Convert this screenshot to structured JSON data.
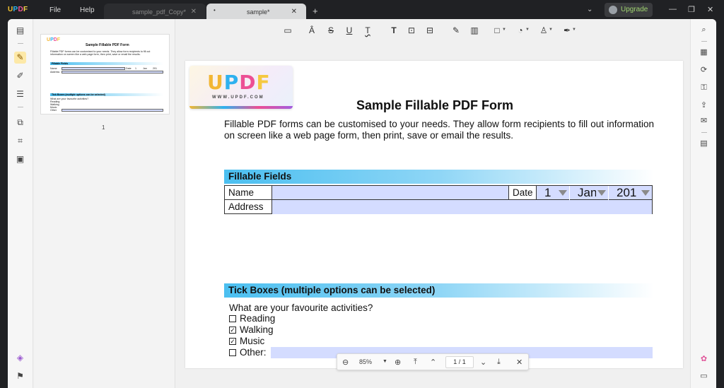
{
  "titlebar": {
    "logo": {
      "u": "U",
      "p": "P",
      "d": "D",
      "f": "F"
    },
    "menu": [
      "File",
      "Help"
    ],
    "tabs": [
      {
        "label": "sample_pdf_Copy*",
        "active": false
      },
      {
        "label": "sample*",
        "active": true
      }
    ],
    "new_tab": "+",
    "upgrade_label": "Upgrade",
    "window_controls": [
      "minimize-icon",
      "restore-icon",
      "close-icon"
    ]
  },
  "thumbnails": {
    "page_label": "1",
    "mini": {
      "logo": {
        "u": "U",
        "p": "P",
        "d": "D",
        "f": "F"
      },
      "title": "Sample Fillable PDF Form",
      "line1": "Fillable PDF forms can be customised to your needs. They allow form recipients to fill out",
      "line2": "information on screen like a web page form, then print, save or email the results.",
      "fields_head": "Fillable Fields",
      "name": "Name",
      "address": "Address",
      "date": "Date",
      "d1": "1",
      "d2": "Jan",
      "d3": "201",
      "tick_head": "Tick Boxes (multiple options can be selected)",
      "question": "What are your favourite activities?",
      "o1": "Reading",
      "o2": "Walking",
      "o3": "Music",
      "o4": "Other"
    }
  },
  "document": {
    "brand": {
      "u": "U",
      "p": "P",
      "d": "D",
      "f": "F",
      "url": "WWW.UPDF.COM"
    },
    "title": "Sample Fillable PDF Form",
    "intro": "Fillable PDF forms can be customised to your needs. They allow form recipients to fill out information on screen like a web page form, then print, save or email the results.",
    "fillable_header": "Fillable Fields",
    "name_label": "Name",
    "address_label": "Address",
    "date_label": "Date",
    "date_day": "1",
    "date_month": "Jan",
    "date_year": "201",
    "tick_header": "Tick Boxes (multiple options can be selected)",
    "question": "What are your favourite activities?",
    "options": [
      {
        "label": "Reading",
        "checked": false
      },
      {
        "label": "Walking",
        "checked": true
      },
      {
        "label": "Music",
        "checked": true
      },
      {
        "label": "Other:",
        "checked": false
      }
    ],
    "check_mark": "✓"
  },
  "bottom_nav": {
    "zoom": "85%",
    "page_current": "1",
    "page_sep": "/",
    "page_total": "1"
  },
  "colors": {
    "accent_yellow": "#fde9a8",
    "field_fill": "#d4dcff",
    "section_gradient_start": "#4bbff0",
    "upgrade_text": "#9fd36f"
  }
}
